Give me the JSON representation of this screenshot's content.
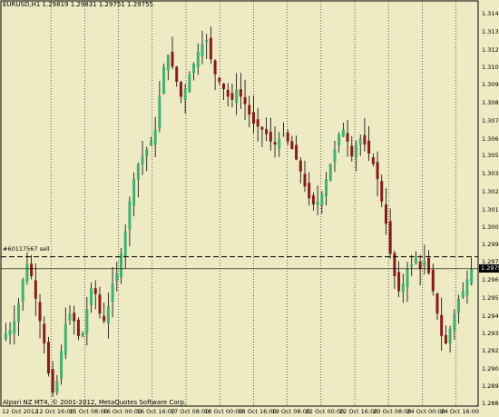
{
  "window": {
    "symbol_header": "EURUSD,H1  1.29819 1.29831 1.29751 1.29755",
    "copyright": "Alpari NZ MT4, © 2001-2012, MetaQuotes Software Corp.",
    "order_label": "#60117567 sell",
    "current_price": "1.2975"
  },
  "colors": {
    "background": "#eeebc4",
    "bull_candle": "#3cb371",
    "bear_candle": "#8b1a1a",
    "wick": "#000000",
    "grid": "#000000",
    "axis_text": "#000000"
  },
  "axis": {
    "price_ticks": [
      "1.31455",
      "1.31335",
      "1.31215",
      "1.31095",
      "1.30980",
      "1.30860",
      "1.30740",
      "1.30620",
      "1.30505",
      "1.30385",
      "1.30265",
      "1.30145",
      "1.30030",
      "1.29910",
      "1.29795",
      "1.29675",
      "1.29555",
      "1.29435",
      "1.29315",
      "1.29200",
      "1.29080",
      "1.28965",
      "1.28850"
    ],
    "time_ticks": [
      "12 Oct 2012",
      "12 Oct 16:00",
      "15 Oct 08:00",
      "16 Oct 00:00",
      "16 Oct 16:00",
      "17 Oct 08:00",
      "18 Oct 00:00",
      "18 Oct 16:00",
      "19 Oct 08:00",
      "22 Oct 00:00",
      "22 Oct 16:00",
      "23 Oct 08:00",
      "24 Oct 00:00",
      "24 Oct 16:00"
    ]
  },
  "chart_data": {
    "type": "candlestick",
    "symbol": "EURUSD",
    "timeframe": "H1",
    "ylim": [
      1.2885,
      1.3151
    ],
    "sell_order_price": 1.2983,
    "current_price": 1.2975,
    "grid": "vertical-dotted",
    "period_separators": [
      "12 Oct 16:00",
      "15 Oct 08:00",
      "16 Oct 00:00",
      "16 Oct 16:00",
      "17 Oct 08:00",
      "18 Oct 00:00",
      "18 Oct 16:00",
      "19 Oct 08:00",
      "22 Oct 00:00",
      "22 Oct 16:00",
      "23 Oct 08:00",
      "24 Oct 00:00",
      "24 Oct 16:00"
    ],
    "close_path": [
      1.2932,
      1.2934,
      1.294,
      1.2952,
      1.2968,
      1.2978,
      1.297,
      1.2955,
      1.294,
      1.2925,
      1.2905,
      1.2892,
      1.29,
      1.292,
      1.2938,
      1.2945,
      1.294,
      1.293,
      1.2932,
      1.2948,
      1.2962,
      1.2958,
      1.2945,
      1.294,
      1.295,
      1.2965,
      1.2972,
      1.2985,
      1.3,
      1.302,
      1.3035,
      1.3045,
      1.305,
      1.3055,
      1.306,
      1.3068,
      1.309,
      1.311,
      1.3118,
      1.311,
      1.31,
      1.309,
      1.3095,
      1.3105,
      1.3112,
      1.312,
      1.3125,
      1.3128,
      1.3115,
      1.3105,
      1.31,
      1.3095,
      1.309,
      1.3088,
      1.3095,
      1.309,
      1.3085,
      1.3078,
      1.3072,
      1.307,
      1.3068,
      1.3065,
      1.306,
      1.3058,
      1.3062,
      1.3065,
      1.306,
      1.3055,
      1.3048,
      1.304,
      1.303,
      1.3022,
      1.3018,
      1.302,
      1.3025,
      1.3035,
      1.3045,
      1.3055,
      1.3065,
      1.3068,
      1.306,
      1.305,
      1.3058,
      1.3062,
      1.3058,
      1.3052,
      1.3045,
      1.3035,
      1.302,
      1.3005,
      1.2985,
      1.297,
      1.296,
      1.2965,
      1.2975,
      1.2978,
      1.2982,
      1.2975,
      1.298,
      1.2972,
      1.296,
      1.2945,
      1.293,
      1.2925,
      1.2935,
      1.2945,
      1.2955,
      1.296,
      1.2968,
      1.2975
    ]
  }
}
